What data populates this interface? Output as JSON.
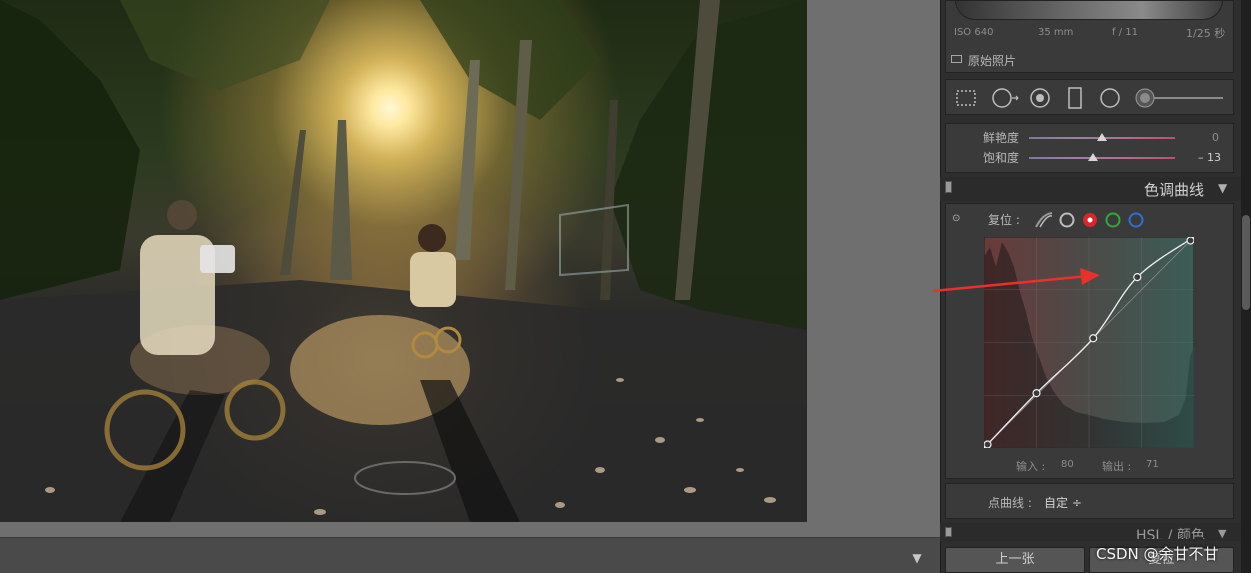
{
  "photo": {
    "description_icon": "bicycle-street-photo"
  },
  "histogram": {
    "iso": "ISO 640",
    "focal_length": "35 mm",
    "aperture": "f / 11",
    "shutter": "1/25 秒",
    "original_photo_label": "原始照片"
  },
  "tools": [
    "crop-icon",
    "spot-removal-icon",
    "red-eye-icon",
    "graduated-filter-icon",
    "radial-filter-icon",
    "adjustment-brush-icon"
  ],
  "basic": {
    "vibrance_label": "鲜艳度",
    "vibrance_value": "0",
    "vibrance_level": 0.5,
    "saturation_label": "饱和度",
    "saturation_value": "– 13",
    "saturation_level": 0.44
  },
  "tone_curve": {
    "title": "色调曲线",
    "reset_label": "复位 :",
    "input_label": "输入 :",
    "input_value": "80",
    "output_label": "输出 :",
    "output_value": "71",
    "point_curve_label": "点曲线 :",
    "point_curve_value": "自定 ÷",
    "curve_points": [
      [
        0,
        0
      ],
      [
        0.25,
        0.26
      ],
      [
        0.52,
        0.52
      ],
      [
        0.73,
        0.81
      ],
      [
        1,
        1
      ]
    ]
  },
  "hsl": {
    "title": "HSL / 颜色"
  },
  "buttons": {
    "previous_label": "上一张",
    "reset_label": "复位"
  },
  "watermark": "CSDN @余甘不甘",
  "colors": {
    "annotation_arrow": "#e8312a",
    "red_channel": "#d9262c",
    "green_channel": "#32a83a",
    "blue_channel": "#2f6fd6"
  }
}
